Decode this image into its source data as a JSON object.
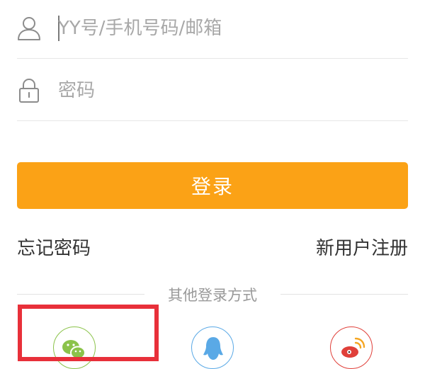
{
  "form": {
    "username_placeholder": "YY号/手机号码/邮箱",
    "username_value": "",
    "password_placeholder": "密码",
    "password_value": "",
    "login_label": "登录"
  },
  "links": {
    "forgot_password": "忘记密码",
    "register": "新用户注册"
  },
  "other_login": {
    "label": "其他登录方式",
    "options": [
      {
        "name": "wechat",
        "icon": "wechat-icon",
        "color": "#8bc34a"
      },
      {
        "name": "qq",
        "icon": "qq-icon",
        "color": "#5aa9e6"
      },
      {
        "name": "weibo",
        "icon": "weibo-icon",
        "color": "#e0403a"
      }
    ]
  },
  "colors": {
    "accent": "#fba216",
    "highlight": "#e8303a",
    "placeholder": "#a8a8a8",
    "divider": "#e6e6e6"
  }
}
